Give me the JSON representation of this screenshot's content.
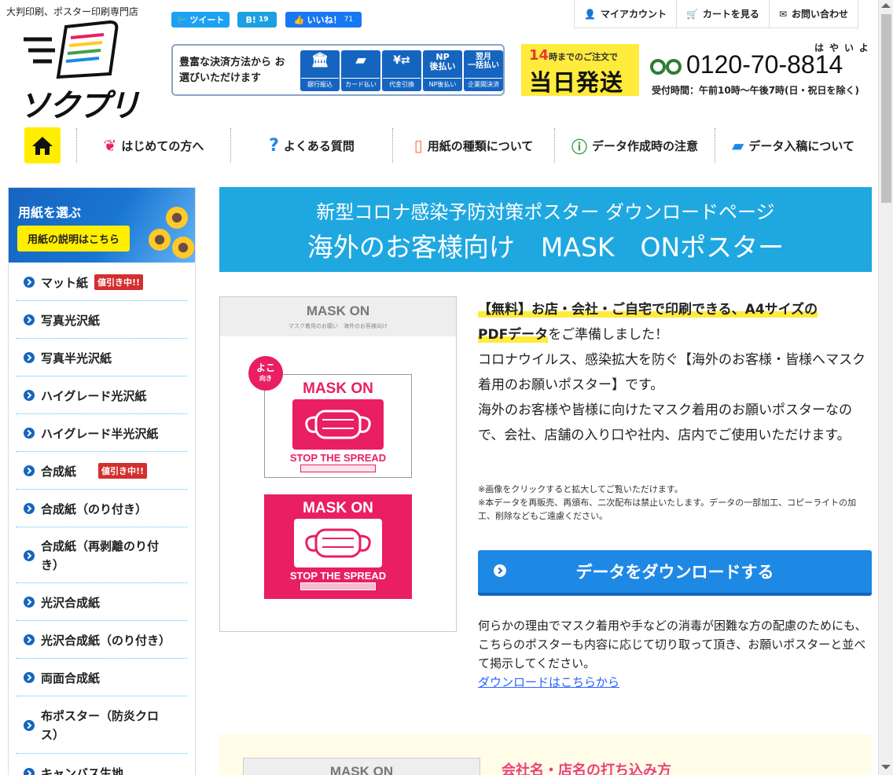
{
  "header": {
    "tagline": "大判印刷、ポスター印刷専門店",
    "logo_text": "ソクプリ",
    "social": {
      "tweet": "ツイート",
      "hatena": "B!",
      "hatena_count": "19",
      "like": "いいね！",
      "like_count": "71"
    },
    "payment": {
      "text": "豊富な決済方法から お選びいただけます",
      "methods": [
        {
          "icon": "bank-icon",
          "label": "銀行振込",
          "glyph": "🏛"
        },
        {
          "icon": "card-icon",
          "label": "カード払い",
          "glyph": "▰"
        },
        {
          "icon": "cod-icon",
          "label": "代金引換",
          "glyph": "¥⇄"
        },
        {
          "icon": "np-icon",
          "label": "NP後払い",
          "glyph": "NP 後払い"
        },
        {
          "icon": "monthly-icon",
          "label": "企業間決済",
          "glyph": "翌月 一括払い"
        }
      ]
    },
    "same_day": {
      "hour": "14",
      "suffix": "時までのご注文で",
      "big": "当日発送"
    },
    "phone": {
      "ruby": "はやいよ",
      "number": "0120-70-8814",
      "hours": "受付時間：午前10時〜午後7時(日・祝日を除く)"
    },
    "top_nav": [
      {
        "icon": "user-icon",
        "label": "マイアカウント"
      },
      {
        "icon": "cart-icon",
        "label": "カートを見る"
      },
      {
        "icon": "mail-icon",
        "label": "お問い合わせ"
      }
    ]
  },
  "main_nav": [
    {
      "icon": "beginner-icon",
      "label": "はじめての方へ"
    },
    {
      "icon": "question-icon",
      "label": "よくある質問"
    },
    {
      "icon": "paper-icon",
      "label": "用紙の種類について"
    },
    {
      "icon": "warning-icon",
      "label": "データ作成時の注意"
    },
    {
      "icon": "folder-icon",
      "label": "データ入稿について"
    }
  ],
  "sidebar": {
    "title": "用紙を選ぶ",
    "button": "用紙の説明はこちら",
    "sale_badge": "値引き中!!",
    "items": [
      {
        "label": "マット紙",
        "sale": true
      },
      {
        "label": "写真光沢紙",
        "sale": false
      },
      {
        "label": "写真半光沢紙",
        "sale": false
      },
      {
        "label": "ハイグレード光沢紙",
        "sale": false
      },
      {
        "label": "ハイグレード半光沢紙",
        "sale": false
      },
      {
        "label": "合成紙",
        "sale": true
      },
      {
        "label": "合成紙（のり付き）",
        "sale": false
      },
      {
        "label": "合成紙（再剥離のり付き）",
        "sale": false
      },
      {
        "label": "光沢合成紙",
        "sale": false
      },
      {
        "label": "光沢合成紙（のり付き）",
        "sale": false
      },
      {
        "label": "両面合成紙",
        "sale": false
      },
      {
        "label": "布ポスター（防炎クロス）",
        "sale": false
      },
      {
        "label": "キャンバス生地",
        "sale": false
      }
    ]
  },
  "banner": {
    "line1": "新型コロナ感染予防対策ポスター ダウンロードページ",
    "line2": "海外のお客様向け　MASK　ONポスター"
  },
  "preview": {
    "title": "MASK ON",
    "subtitle": "マスク着用のお願い　海外のお客様向け",
    "yoko": "よこ",
    "yoko_sub": "向き",
    "poster_title": "MASK ON",
    "poster_footer": "STOP THE SPREAD"
  },
  "description": {
    "highlight1": "【無料】お店・会社・ご自宅で印刷できる、A4サイズの",
    "highlight2": "PDFデータ",
    "text1": "をご準備しました！",
    "text2": "コロナウイルス、感染拡大を防ぐ【海外のお客様・皆様へマスク着用のお願いポスター】です。",
    "text3": "海外のお客様や皆様に向けたマスク着用のお願いポスターなので、会社、店舗の入り口や社内、店内でご使用いただけます。"
  },
  "notes": {
    "note1": "※画像をクリックすると拡大してご覧いただけます。",
    "note2": "※本データを再販売、再頒布、二次配布は禁止いたします。データの一部加工、コピーライトの加工、削除などもご遠慮ください。"
  },
  "download_button": "データをダウンロードする",
  "para2": {
    "text": "何らかの理由でマスク着用や手などの消毒が困難な方の配慮のためにも、こちらのポスターも内容に応じて切り取って頂き、お願いポスターと並べて掲示してください。",
    "link": "ダウンロードはこちらから"
  },
  "section2": {
    "thumb_title": "MASK ON",
    "title": "会社名・店名の打ち込み方"
  },
  "colors": {
    "accent": "#1fa8e0",
    "yellow": "#ffee00",
    "pink": "#e91e63",
    "navy": "#1565c0"
  }
}
